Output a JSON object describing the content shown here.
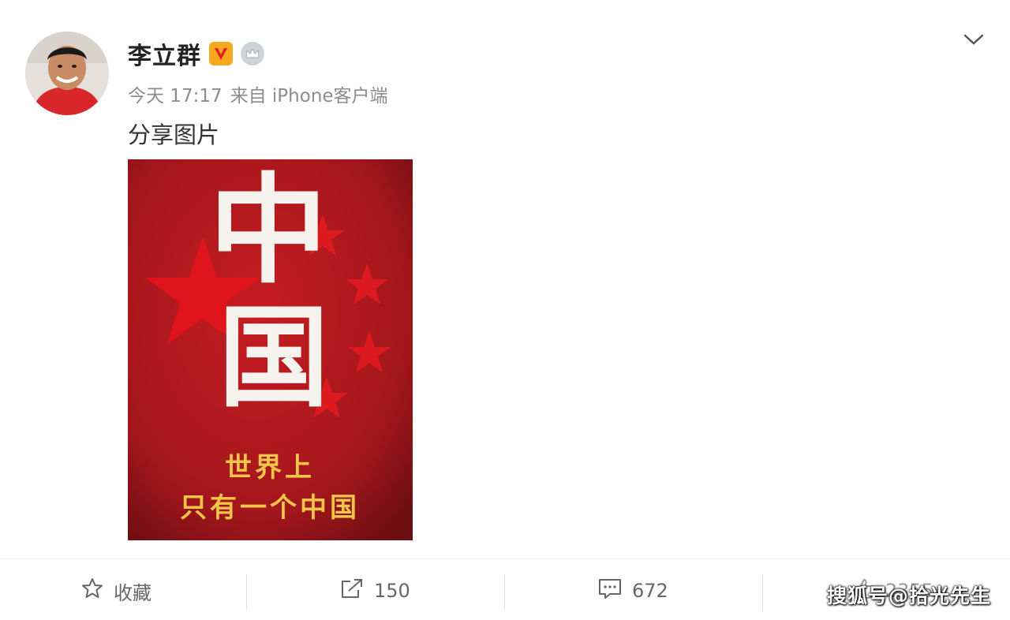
{
  "user": {
    "name": "李立群",
    "avatar_icon": "avatar-photo",
    "badges": [
      "verified-v-icon",
      "crown-icon"
    ],
    "verified_color": "#f6a821"
  },
  "meta": {
    "time": "今天 17:17",
    "source": "来自 iPhone客户端"
  },
  "post": {
    "text": "分享图片",
    "image": {
      "big_chars": [
        "中",
        "国"
      ],
      "caption_line1": "世界上",
      "caption_line2": "只有一个中国",
      "background_color": "#a3161b",
      "caption_color": "#f0c54a"
    }
  },
  "actions": {
    "favorite": {
      "label": "收藏",
      "icon": "star-icon"
    },
    "share": {
      "count": "150",
      "icon": "share-icon"
    },
    "comment": {
      "count": "672",
      "icon": "comment-icon"
    },
    "like": {
      "count": "2355",
      "icon": "like-icon"
    }
  },
  "watermark": "搜狐号@拾光先生"
}
